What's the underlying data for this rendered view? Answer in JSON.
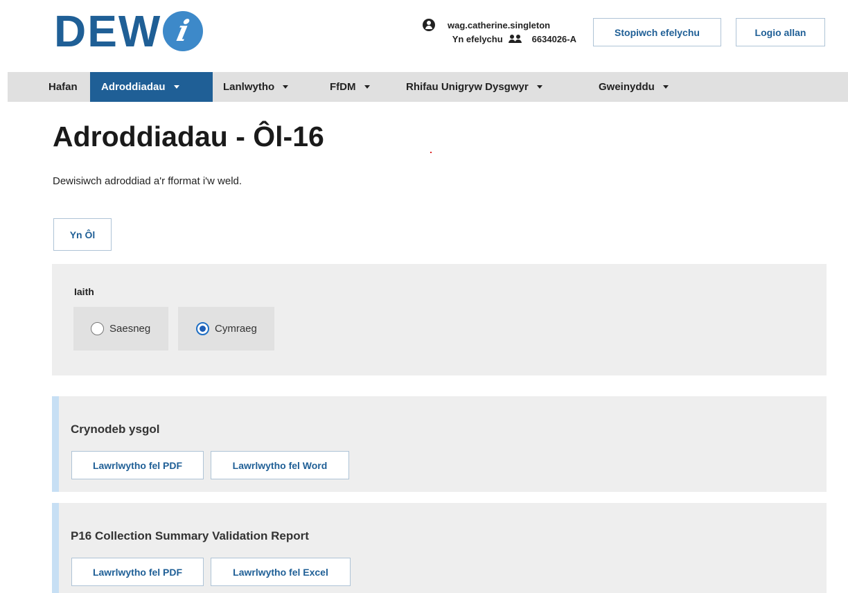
{
  "logo": {
    "text": "DEW",
    "badge_letter": "i"
  },
  "user": {
    "username": "wag.catherine.singleton",
    "impersonating_label": "Yn efelychu",
    "impersonated_id": "6634026-A"
  },
  "header": {
    "stop_impersonating_label": "Stopiwch efelychu",
    "logout_label": "Logio allan"
  },
  "nav": {
    "home": "Hafan",
    "reports": "Adroddiadau",
    "upload": "Lanlwytho",
    "ffdm": "FfDM",
    "upn": "Rhifau Unigryw Dysgwyr",
    "admin": "Gweinyddu"
  },
  "page": {
    "title": "Adroddiadau - Ôl-16",
    "intro": "Dewisiwch adroddiad a'r fformat i'w weld.",
    "back_label": "Yn Ôl"
  },
  "language": {
    "label": "Iaith",
    "options": [
      "Saesneg",
      "Cymraeg"
    ],
    "selected": "Cymraeg"
  },
  "reports": [
    {
      "title": "Crynodeb ysgol",
      "buttons": [
        "Lawrlwytho fel PDF",
        "Lawrlwytho fel Word"
      ]
    },
    {
      "title": "P16 Collection Summary Validation Report",
      "buttons": [
        "Lawrlwytho fel PDF",
        "Lawrlwytho fel Excel"
      ]
    }
  ],
  "colors": {
    "brand": "#1f5f96",
    "logo_badge": "#3d89c9",
    "nav_bg": "#e0e0e0",
    "panel_bg": "#eeeeee",
    "report_accent": "#c7dff4"
  },
  "icons": {
    "user": "user-circle-icon",
    "impersonate": "users-icon",
    "dropdown": "caret-down-icon"
  }
}
